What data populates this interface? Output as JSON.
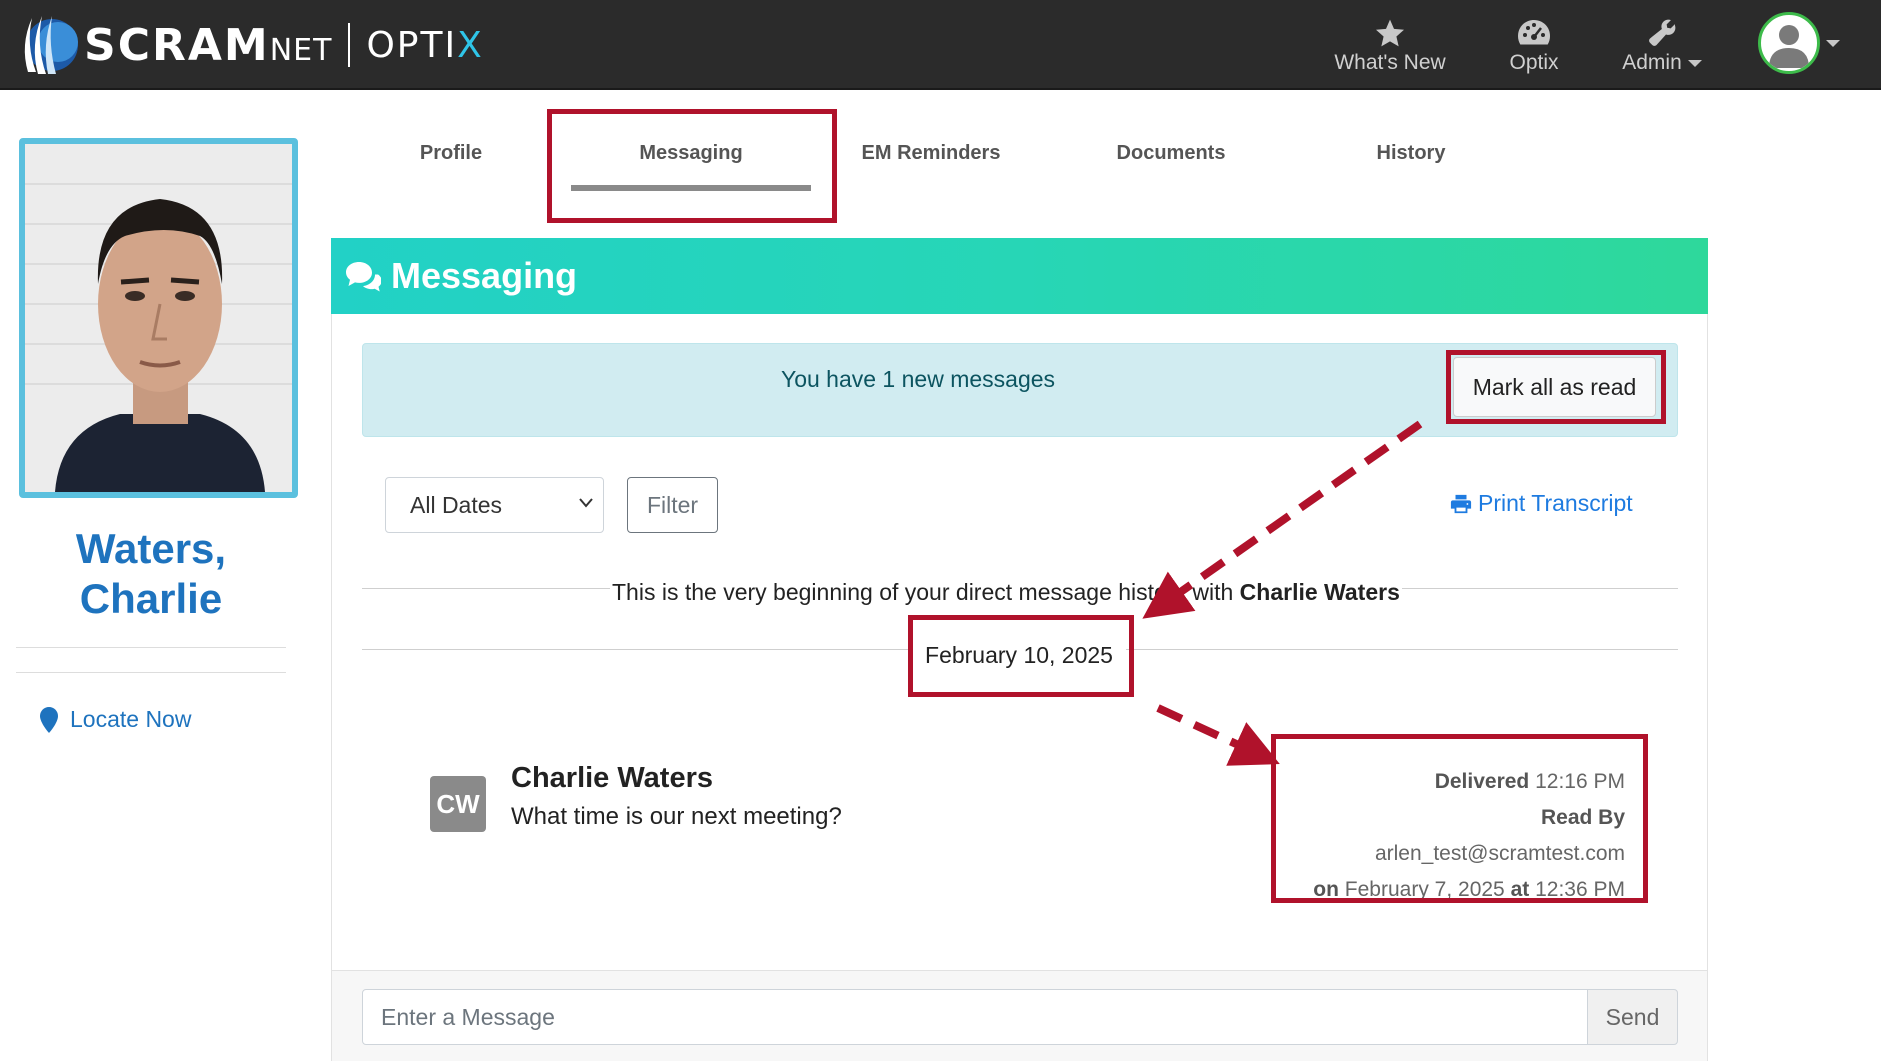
{
  "navbar": {
    "brand_scram": "SCRAM",
    "brand_net": "NET",
    "brand_optix_main": "OPTI",
    "brand_optix_x": "X",
    "items": [
      {
        "label": "What's New",
        "icon": "star-icon"
      },
      {
        "label": "Optix",
        "icon": "dashboard-gauge-icon"
      },
      {
        "label": "Admin",
        "icon": "wrench-icon"
      }
    ],
    "user_icon": "user-avatar-icon"
  },
  "profile": {
    "name_line1": "Waters,",
    "name_line2": "Charlie",
    "locate_label": "Locate Now",
    "name_color": "#1e73be"
  },
  "tabs": [
    {
      "label": "Profile"
    },
    {
      "label": "Messaging",
      "active": true
    },
    {
      "label": "EM Reminders"
    },
    {
      "label": "Documents"
    },
    {
      "label": "History"
    }
  ],
  "messaging": {
    "header_title": "Messaging",
    "header_icon": "chat-bubbles-icon",
    "alert_text": "You have 1 new messages",
    "mark_all_read_label": "Mark all as read",
    "date_filter_selected": "All Dates",
    "filter_label": "Filter",
    "print_label": "Print Transcript",
    "history_intro": "This is the very beginning of your direct message history with",
    "history_name": "Charlie Waters",
    "date_separator": "February 10, 2025",
    "messages": [
      {
        "initials": "CW",
        "author": "Charlie Waters",
        "text": "What time is our next meeting?",
        "delivered_label": "Delivered",
        "delivered_time": "12:16 PM",
        "read_by_label": "Read By",
        "read_by_user": "arlen_test@scramtest.com",
        "on_label": "on",
        "read_date": "February 7, 2025",
        "at_label": "at",
        "read_time": "12:36 PM"
      }
    ],
    "input_placeholder": "Enter a Message",
    "send_label": "Send"
  },
  "colors": {
    "navbar_bg": "#2b2b2b",
    "header_gradient_start": "#22d1c6",
    "header_gradient_end": "#2ed89b",
    "alert_bg": "#d1ecf1",
    "annotation_red": "#b0122b",
    "link_blue": "#1e7be0"
  }
}
